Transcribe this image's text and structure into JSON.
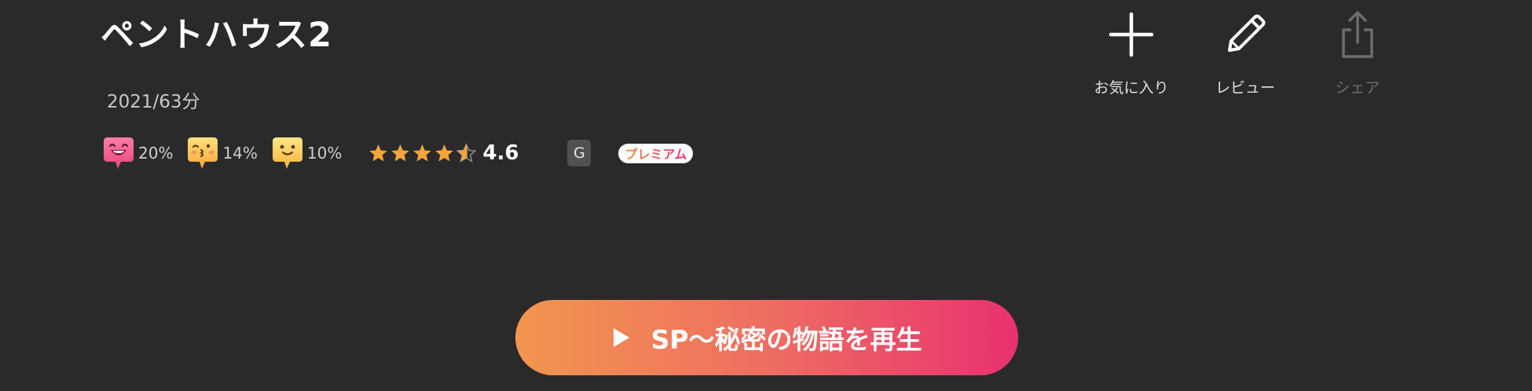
{
  "title": "ペントハウス2",
  "meta": "2021/63分",
  "reactions": [
    {
      "icon": "laughing-emoji-icon",
      "percent": "20%"
    },
    {
      "icon": "kissing-emoji-icon",
      "percent": "14%"
    },
    {
      "icon": "smiling-emoji-icon",
      "percent": "10%"
    }
  ],
  "rating": {
    "value": "4.6",
    "stars": 4.6
  },
  "age_rating": "G",
  "premium_label": "プレミアム",
  "actions": {
    "favorite": "お気に入り",
    "review": "レビュー",
    "share": "シェア"
  },
  "play_button": {
    "label": "SP〜秘密の物語を再生"
  },
  "colors": {
    "background": "#2a2a2a",
    "accent_start": "#f2964f",
    "accent_end": "#e8316f",
    "star": "#f6a53a"
  }
}
